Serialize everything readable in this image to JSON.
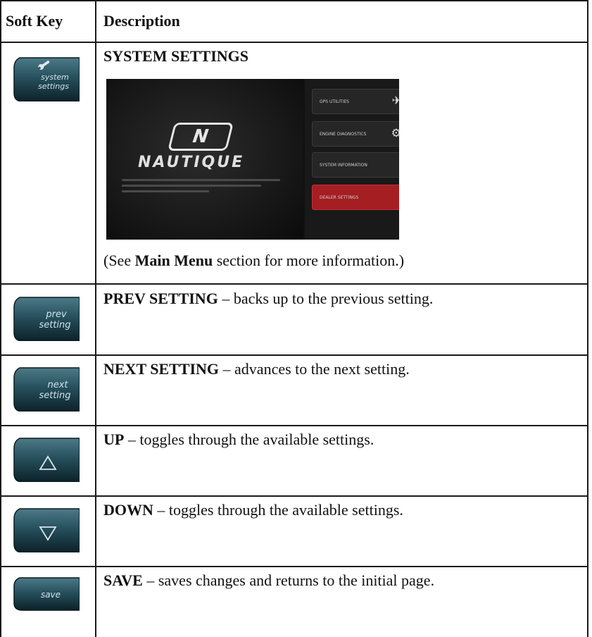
{
  "header": {
    "col1": "Soft Key",
    "col2": "Description"
  },
  "rows": [
    {
      "key_label_line1": "system",
      "key_label_line2": "settings",
      "key_icon": "wrench-icon",
      "title": "SYSTEM SETTINGS",
      "note_prefix": "(See ",
      "note_bold": "Main Menu",
      "note_suffix": " section for more information.)",
      "screenshot": {
        "brand": "NAUTIQUE",
        "logo_letter": "N",
        "menu": [
          "GPS UTILITIES",
          "ENGINE DIAGNOSTICS",
          "SYSTEM INFORMATION",
          "DEALER SETTINGS"
        ]
      }
    },
    {
      "key_label_line1": "prev",
      "key_label_line2": "setting",
      "title": "PREV SETTING",
      "text": " – backs up to the previous setting."
    },
    {
      "key_label_line1": "next",
      "key_label_line2": "setting",
      "title": "NEXT SETTING",
      "text": " – advances to the next setting."
    },
    {
      "key_icon": "up-triangle-icon",
      "title": "UP",
      "text": " – toggles through the available settings."
    },
    {
      "key_icon": "down-triangle-icon",
      "title": "DOWN",
      "text": " – toggles through the available settings."
    },
    {
      "key_label_line1": "save",
      "title": "SAVE",
      "text": " – saves changes and returns to the initial page."
    }
  ],
  "colors": {
    "key_dark": "#0f2a33",
    "key_mid": "#2f5866",
    "menu_highlight": "#a51e22"
  }
}
